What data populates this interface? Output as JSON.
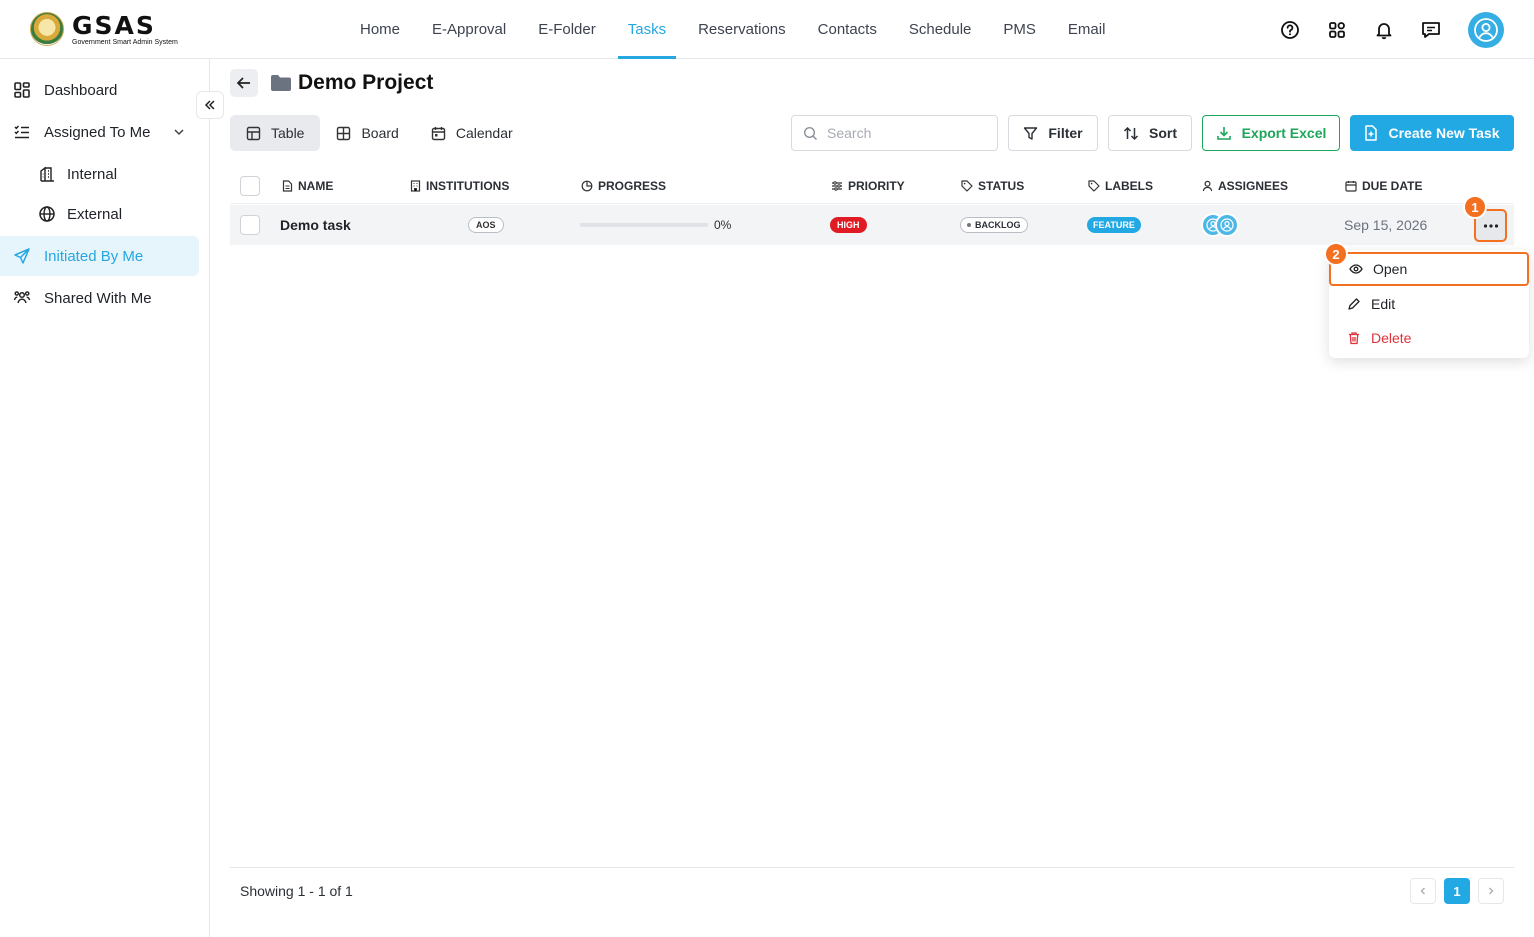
{
  "app": {
    "logo_title": "GSAS",
    "logo_subtitle": "Government Smart Admin System"
  },
  "nav": {
    "items": [
      "Home",
      "E-Approval",
      "E-Folder",
      "Tasks",
      "Reservations",
      "Contacts",
      "Schedule",
      "PMS",
      "Email"
    ],
    "active": "Tasks"
  },
  "sidebar": {
    "items": [
      {
        "label": "Dashboard",
        "icon": "dashboard-icon"
      },
      {
        "label": "Assigned To Me",
        "icon": "list-check-icon"
      },
      {
        "label": "Internal",
        "icon": "building-icon"
      },
      {
        "label": "External",
        "icon": "globe-icon"
      },
      {
        "label": "Initiated By Me",
        "icon": "send-icon"
      },
      {
        "label": "Shared With Me",
        "icon": "users-icon"
      }
    ],
    "active": "Initiated By Me"
  },
  "page": {
    "title": "Demo Project"
  },
  "views": {
    "table": "Table",
    "board": "Board",
    "calendar": "Calendar"
  },
  "toolbar": {
    "search_placeholder": "Search",
    "filter": "Filter",
    "sort": "Sort",
    "export": "Export Excel",
    "create": "Create New Task"
  },
  "table": {
    "headers": {
      "name": "NAME",
      "institutions": "INSTITUTIONS",
      "progress": "PROGRESS",
      "priority": "PRIORITY",
      "status": "STATUS",
      "labels": "LABELS",
      "assignees": "ASSIGNEES",
      "due_date": "DUE DATE"
    },
    "rows": [
      {
        "name": "Demo task",
        "institution": "AOS",
        "progress": 0,
        "progress_text": "0%",
        "priority": "HIGH",
        "status": "BACKLOG",
        "label": "FEATURE",
        "due_date": "Sep 15, 2026"
      }
    ]
  },
  "row_menu": {
    "open": "Open",
    "edit": "Edit",
    "delete": "Delete"
  },
  "annotations": {
    "step1": "1",
    "step2": "2"
  },
  "footer": {
    "showing": "Showing 1 - 1 of 1",
    "current_page": "1"
  },
  "colors": {
    "accent": "#22a8e3",
    "export": "#1ea65a",
    "priority_high": "#e01b24",
    "highlight": "#f37021",
    "delete": "#e0313a"
  }
}
